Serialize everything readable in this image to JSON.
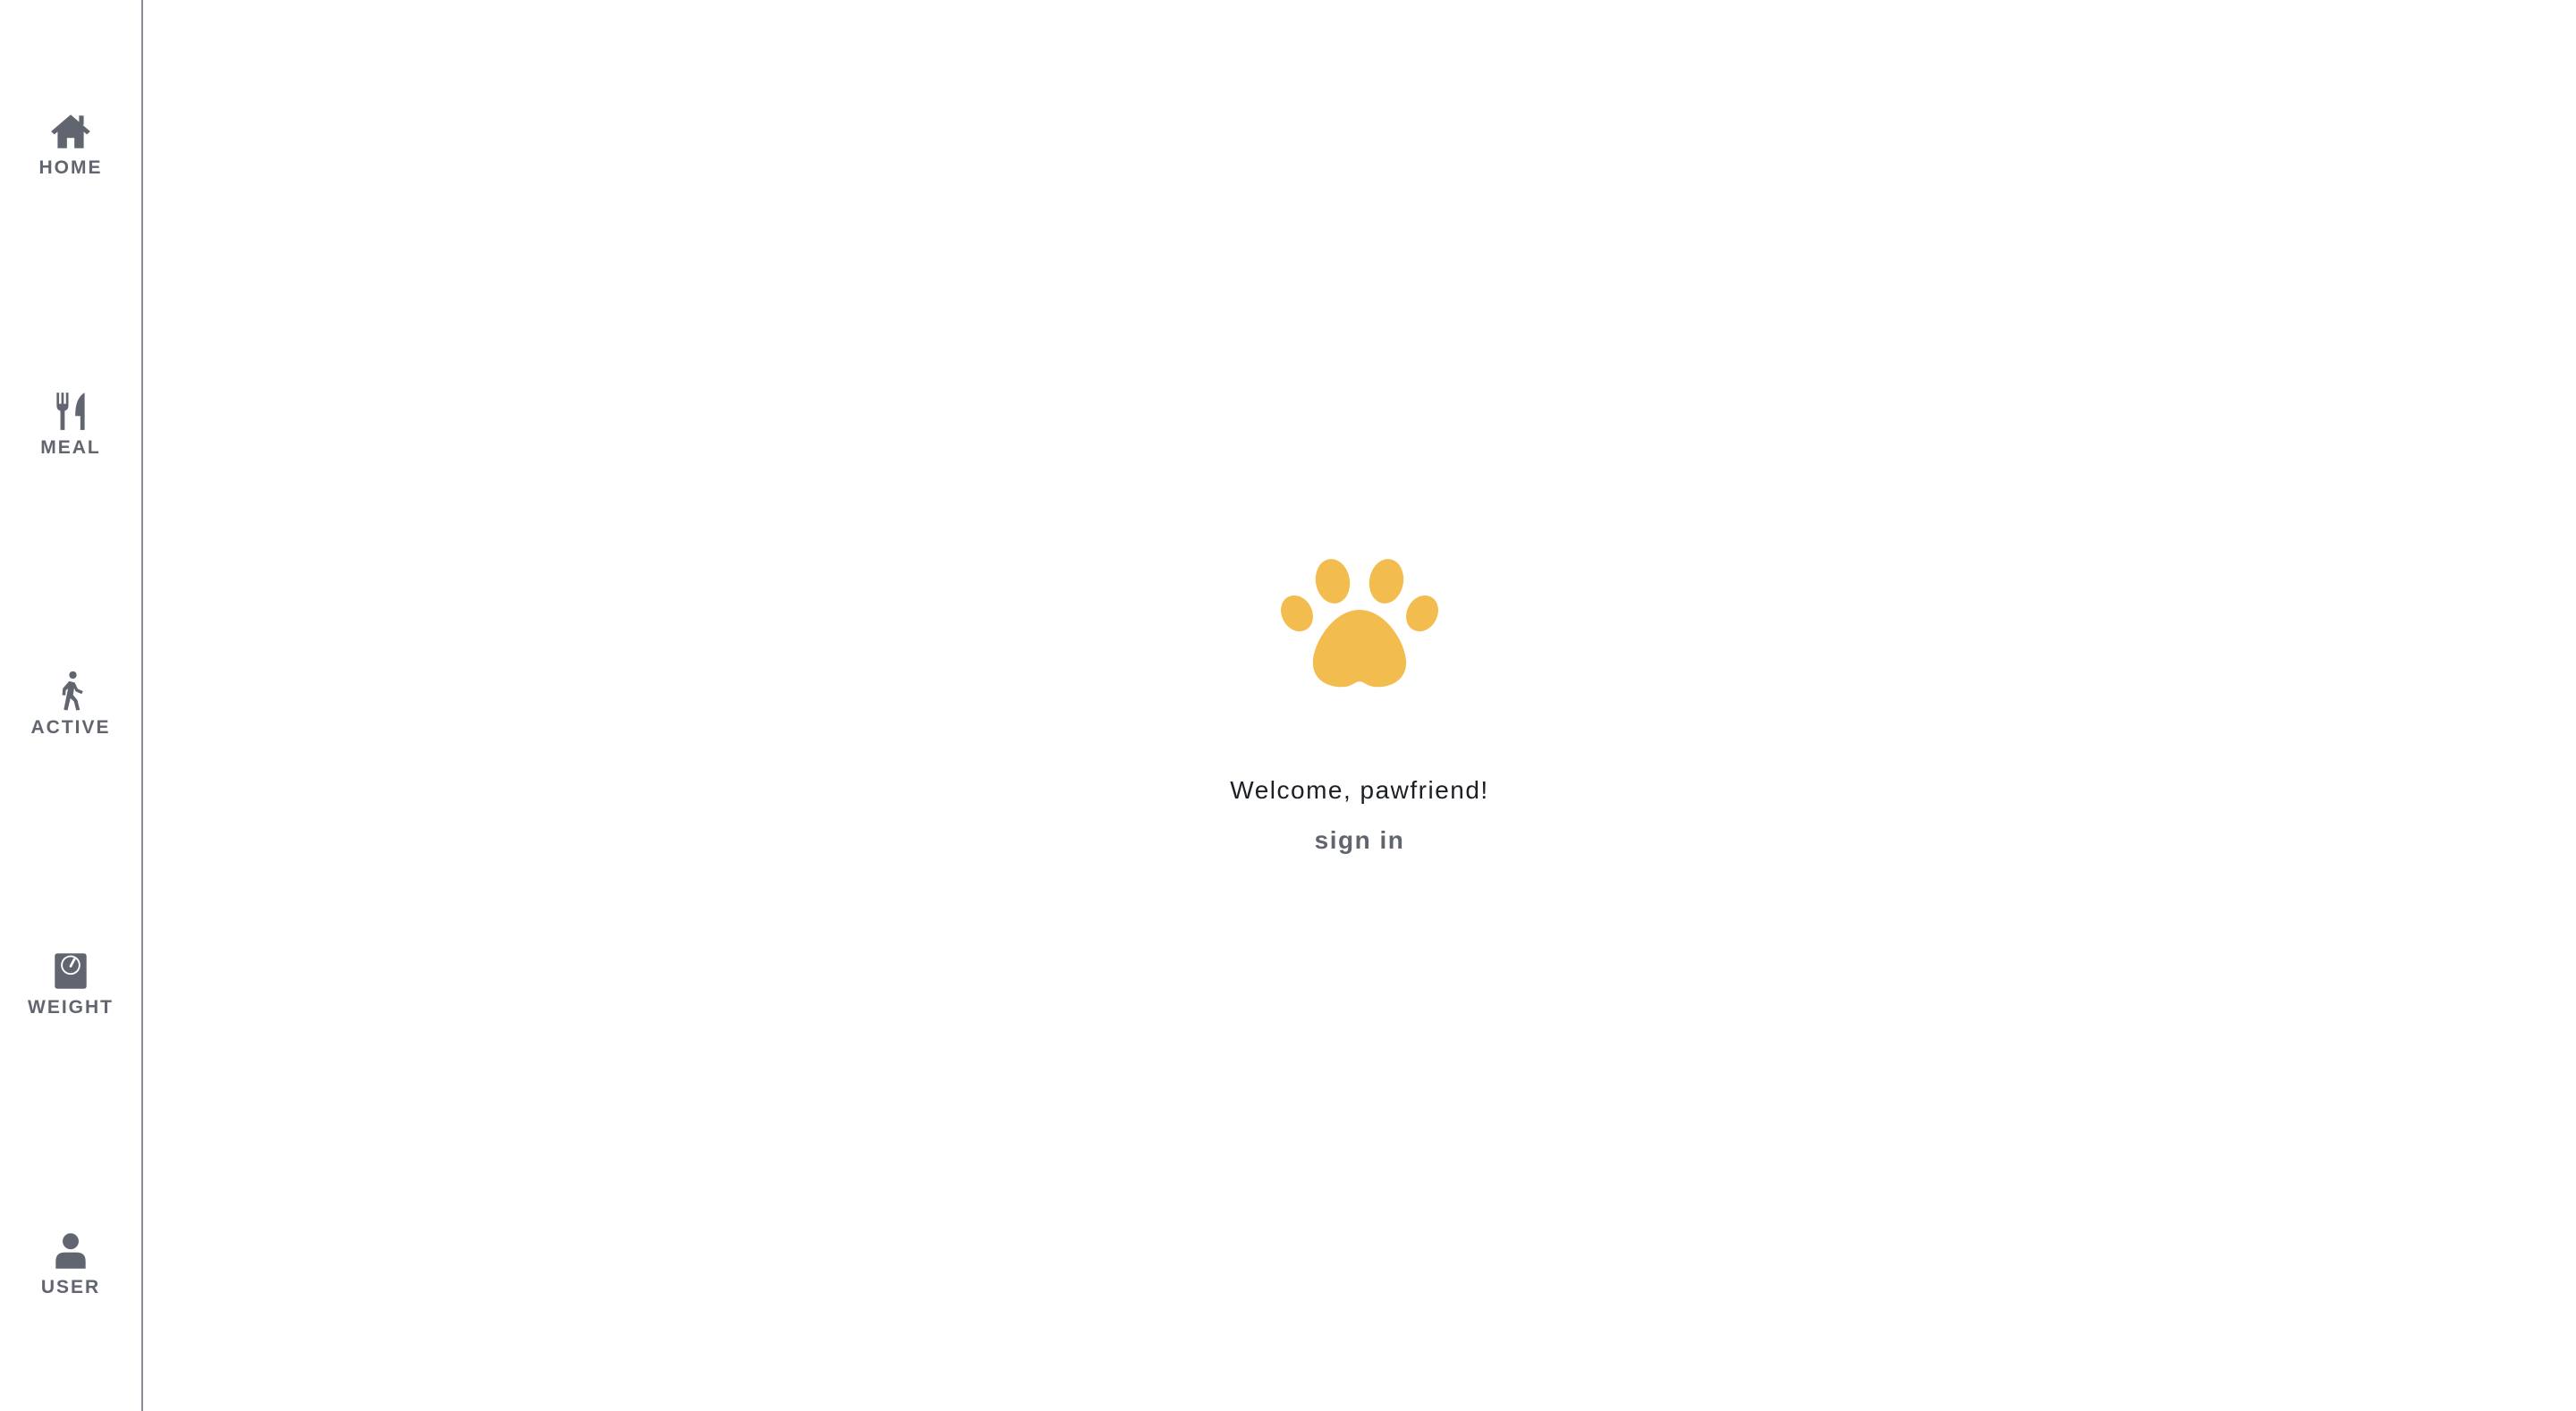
{
  "sidebar": {
    "items": [
      {
        "label": "HOME",
        "icon": "home-icon"
      },
      {
        "label": "MEAL",
        "icon": "utensils-icon"
      },
      {
        "label": "ACTIVE",
        "icon": "walking-icon"
      },
      {
        "label": "WEIGHT",
        "icon": "scale-icon"
      },
      {
        "label": "USER",
        "icon": "user-icon"
      }
    ]
  },
  "main": {
    "logo_icon": "paw-icon",
    "welcome_text": "Welcome, pawfriend!",
    "signin_label": "sign in"
  },
  "colors": {
    "accent": "#f2bd4e",
    "nav_text": "#60656f",
    "text": "#1c1f26",
    "divider": "#8a8d93"
  }
}
